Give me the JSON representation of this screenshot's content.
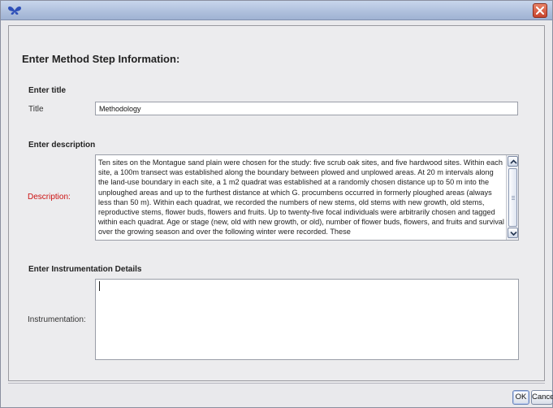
{
  "window": {
    "app_icon": "butterfly-icon",
    "close_icon": "close-icon"
  },
  "dialog": {
    "heading": "Enter Method Step Information:",
    "title_section": "Enter title",
    "title_label": "Title",
    "title_value": "Methodology",
    "description_section": "Enter description",
    "description_label": "Description:",
    "description_value": "Ten sites on the Montague sand plain were chosen for the study: five scrub oak sites, and five hardwood sites. Within each site, a 100m transect was established along the boundary between plowed and unplowed areas. At 20 m intervals along the land-use boundary in each site, a 1 m2 quadrat was established at a randomly chosen distance up to 50 m into the unploughed areas and up to the furthest distance at which G. procumbens occurred in formerly ploughed areas (always less than 50 m). Within each quadrat, we recorded the numbers of new stems, old stems with new growth, old stems, reproductive stems, flower buds, flowers and fruits. Up to twenty-five focal individuals were arbitrarily chosen and tagged within each quadrat. Age or stage (new, old with new growth, or old), number of flower buds, flowers, and fruits and survival over the growing season and over the following winter were recorded. These",
    "instrumentation_section": "Enter Instrumentation Details",
    "instrumentation_label": "Instrumentation:",
    "instrumentation_value": "",
    "description_required_color": "#cc1111"
  },
  "buttons": {
    "ok": "OK",
    "cancel": "Cancel"
  }
}
